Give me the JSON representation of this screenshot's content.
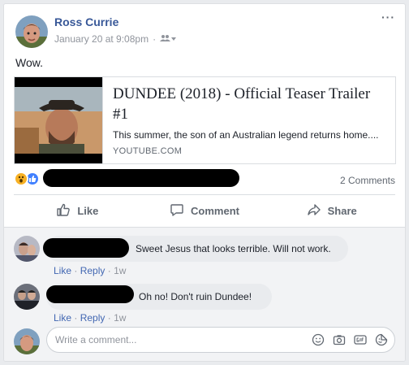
{
  "post": {
    "author": "Ross Currie",
    "timestamp": "January 20 at 9:08pm",
    "separator": "·",
    "audience_icon": "friends-icon",
    "more_label": "···",
    "text": "Wow."
  },
  "link": {
    "title": "DUNDEE (2018) - Official Teaser Trailer #1",
    "description": "This summer, the son of an Australian legend returns home....",
    "domain": "YOUTUBE.COM"
  },
  "reactions": {
    "icons": [
      "wow-reaction-icon",
      "like-reaction-icon"
    ],
    "comments_count": "2 Comments"
  },
  "actions": {
    "like": "Like",
    "comment": "Comment",
    "share": "Share"
  },
  "comments": [
    {
      "text": "Sweet Jesus that looks terrible. Will not work.",
      "like": "Like",
      "reply": "Reply",
      "sep": "·",
      "time": "1w"
    },
    {
      "text": "Oh no! Don't ruin Dundee!",
      "like": "Like",
      "reply": "Reply",
      "sep": "·",
      "time": "1w"
    }
  ],
  "composer": {
    "placeholder": "Write a comment...",
    "icons": [
      "emoji-icon",
      "camera-icon",
      "gif-icon",
      "sticker-icon"
    ]
  },
  "colors": {
    "link_blue": "#385898",
    "background": "#e9ebee",
    "wow": "#f7b125",
    "like": "#4080ff"
  }
}
